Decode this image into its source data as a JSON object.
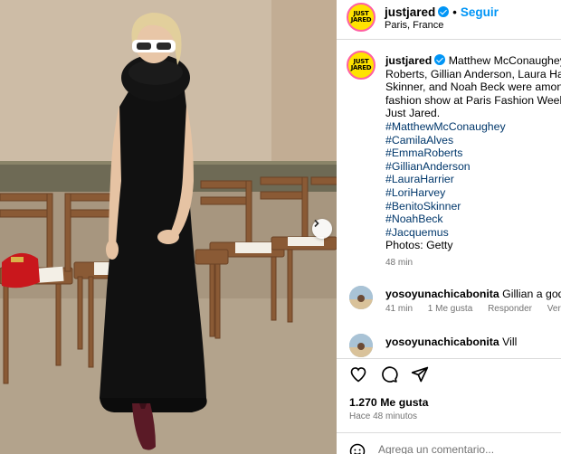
{
  "post": {
    "image_alt_subject": "",
    "carousel_next_icon": "chevron-right-icon"
  },
  "header": {
    "avatar_text": "JUST JARED",
    "username": "justjared",
    "separator": "•",
    "follow_label": "Seguir",
    "location": "Paris, France"
  },
  "caption": {
    "avatar_text": "JUST JARED",
    "username": "justjared",
    "lines": [
      "Matthew McConaughey an",
      "Roberts, Gillian Anderson, Laura Harrie",
      "Skinner, and Noah Beck were among th",
      "fashion show at Paris Fashion Week on",
      "Just Jared."
    ],
    "hashtags": [
      "#MatthewMcConaughey",
      "#CamilaAlves",
      "#EmmaRoberts",
      "#GillianAnderson",
      "#LauraHarrier",
      "#LoriHarvey",
      "#BenitoSkinner",
      "#NoahBeck",
      "#Jacquemus"
    ],
    "credit": "Photos: Getty",
    "time": "48 min"
  },
  "comments": [
    {
      "username": "yosoyunachicabonita",
      "text": "Gillian a goddess",
      "time": "41 min",
      "likes": "1 Me gusta",
      "reply_label": "Responder",
      "translate_label": "Ver traducción"
    },
    {
      "username": "yosoyunachicabonita",
      "text": "Vill"
    }
  ],
  "actions": {
    "like_icon": "heart-icon",
    "comment_icon": "comment-icon",
    "share_icon": "send-icon"
  },
  "likes_label": "1.270 Me gusta",
  "posted_time": "Hace 48 minutos",
  "add_comment": {
    "placeholder": "Agrega un comentario..."
  },
  "colors": {
    "accent": "#0095f6",
    "hashtag": "#00376b",
    "avatar_bg": "#ffe300",
    "avatar_ring": "#ff5fa2",
    "muted": "#737373"
  }
}
